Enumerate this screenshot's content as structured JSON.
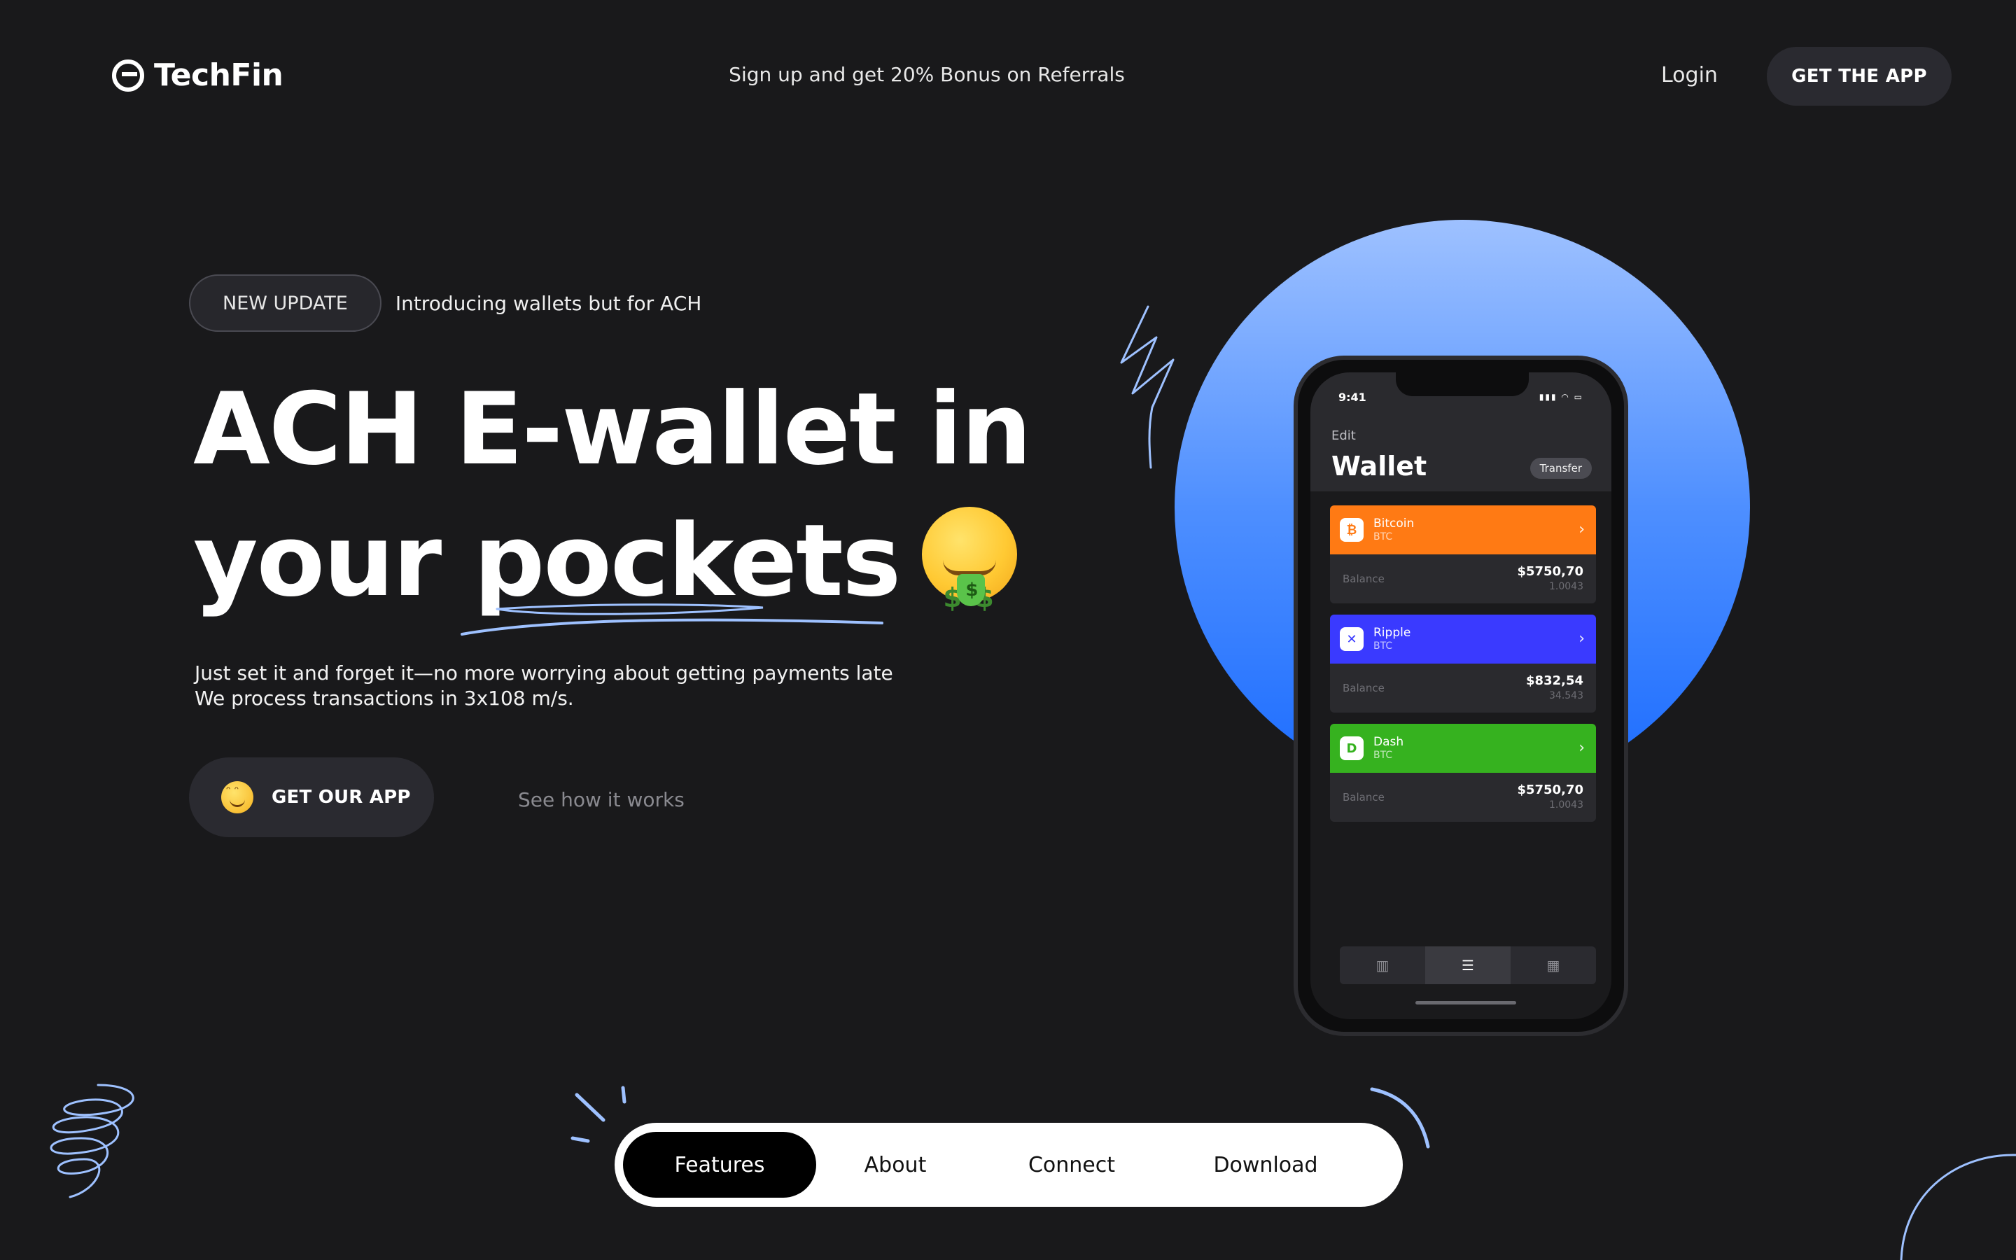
{
  "header": {
    "brand": "TechFin",
    "promo": "Sign up and get 20% Bonus on Referrals",
    "login": "Login",
    "get_app": "GET THE APP"
  },
  "hero": {
    "badge": "NEW UPDATE",
    "badge_text": "Introducing wallets but for ACH",
    "headline_line1": "ACH E-wallet in",
    "headline_line2": "your pockets",
    "subtext_line1": "Just set it and forget it—no more worrying about getting payments late",
    "subtext_line2": "We process transactions in 3x108 m/s.",
    "cta_label": "GET OUR APP",
    "secondary_link": "See how it works"
  },
  "phone": {
    "time": "9:41",
    "edit": "Edit",
    "title": "Wallet",
    "transfer": "Transfer",
    "balance_label": "Balance",
    "coins": [
      {
        "name": "Bitcoin",
        "symbol": "BTC",
        "balance": "$5750,70",
        "amount": "1.0043",
        "color": "#ff7a14"
      },
      {
        "name": "Ripple",
        "symbol": "BTC",
        "balance": "$832,54",
        "amount": "34.543",
        "color": "#3a3aff"
      },
      {
        "name": "Dash",
        "symbol": "BTC",
        "balance": "$5750,70",
        "amount": "1.0043",
        "color": "#36b21f"
      }
    ]
  },
  "bottom_nav": {
    "items": [
      "Features",
      "About",
      "Connect",
      "Download"
    ]
  },
  "colors": {
    "background": "#19191b",
    "accent_blue": "#1a6bff",
    "bitcoin": "#ff7a14",
    "ripple": "#3a3aff",
    "dash": "#36b21f"
  }
}
